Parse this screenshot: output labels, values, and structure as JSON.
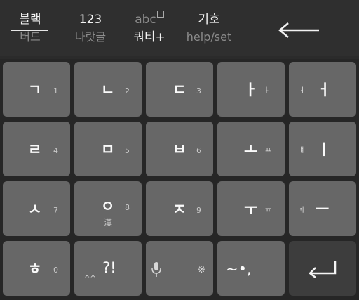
{
  "topbar": {
    "skin_top": "블랙",
    "skin_bottom": "버드",
    "mode_numeric_top": "123",
    "mode_numeric_bottom": "나랏글",
    "mode_abc_top": "abc",
    "mode_abc_bottom": "쿼티+",
    "symbols_top": "기호",
    "symbols_bottom": "help/set"
  },
  "keys": {
    "k1": {
      "glyph": "ㄱ",
      "num": "1"
    },
    "k2": {
      "glyph": "ㄴ",
      "num": "2"
    },
    "k3": {
      "glyph": "ㄷ",
      "num": "3"
    },
    "k4": {
      "glyph": "ㅏ",
      "small": "ㅑ"
    },
    "k5": {
      "glyph": "ㅓ",
      "small": "ㅕ"
    },
    "k6": {
      "glyph": "ㄹ",
      "num": "4"
    },
    "k7": {
      "glyph": "ㅁ",
      "num": "5"
    },
    "k8": {
      "glyph": "ㅂ",
      "num": "6"
    },
    "k9": {
      "glyph": "ㅗ",
      "small": "ㅛ"
    },
    "k10": {
      "glyph": "ㅣ",
      "small": "ㅒ"
    },
    "k11": {
      "glyph": "ㅅ",
      "num": "7"
    },
    "k12": {
      "glyph": "ㅇ",
      "num": "8",
      "sub": "漢"
    },
    "k13": {
      "glyph": "ㅈ",
      "num": "9"
    },
    "k14": {
      "glyph": "ㅜ",
      "small": "ㅠ"
    },
    "k15": {
      "glyph": "ㅡ",
      "small": "ㅖ"
    },
    "k16": {
      "glyph": "ㅎ",
      "num": "0"
    },
    "k17": {
      "glyph": "?!",
      "small": "^^"
    },
    "k18": {
      "glyph": "※"
    },
    "k19": {
      "glyph": "~•,"
    },
    "k20": {
      "label": "enter"
    }
  }
}
